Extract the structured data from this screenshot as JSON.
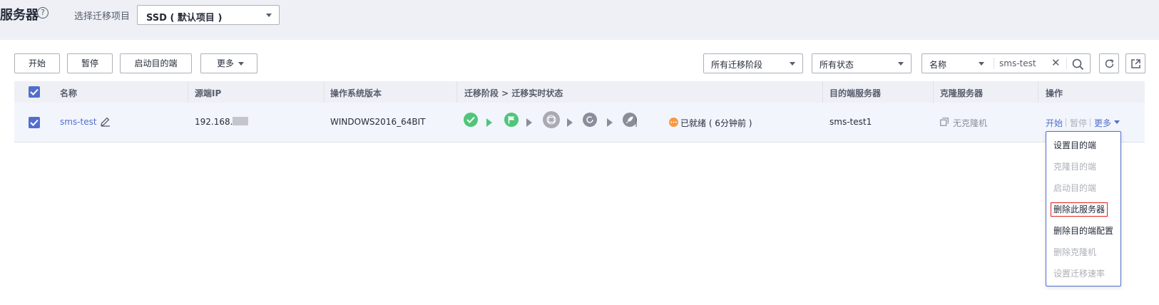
{
  "header": {
    "title": "服务器",
    "help": "?",
    "project_label": "选择迁移项目",
    "project_value": "SSD ( 默认项目 )"
  },
  "toolbar": {
    "start": "开始",
    "pause": "暂停",
    "start_target": "启动目的端",
    "more": "更多",
    "stage_filter": "所有迁移阶段",
    "status_filter": "所有状态",
    "search_field": "名称",
    "search_query": "sms-test"
  },
  "table": {
    "columns": [
      "名称",
      "源端IP",
      "操作系统版本",
      "迁移阶段 > 迁移实时状态",
      "目的端服务器",
      "克隆服务器",
      "操作"
    ],
    "rows": [
      {
        "name": "sms-test",
        "ip": "192.168.",
        "os": "WINDOWS2016_64BIT",
        "separator": "|",
        "status": "已就绪 ( 6分钟前 )",
        "target": "sms-test1",
        "clone": "无克隆机",
        "ops": {
          "start": "开始",
          "pause": "暂停",
          "more": "更多"
        }
      }
    ]
  },
  "menu": {
    "items": [
      {
        "label": "设置目的端",
        "enabled": true
      },
      {
        "label": "克隆目的端",
        "enabled": false
      },
      {
        "label": "启动目的端",
        "enabled": false
      },
      {
        "label": "删除此服务器",
        "enabled": true,
        "highlighted": true
      },
      {
        "label": "删除目的端配置",
        "enabled": true
      },
      {
        "label": "删除克隆机",
        "enabled": false
      },
      {
        "label": "设置迁移速率",
        "enabled": false
      }
    ]
  },
  "colors": {
    "accent": "#526ecc",
    "success": "#50c57a",
    "pending": "#8a8e99",
    "warning": "#fa9841",
    "highlight_border": "#e02020"
  },
  "icons": {
    "stage1": "check-circle-icon",
    "stage2": "flag-icon",
    "stage3": "sync-icon",
    "stage4": "refresh-icon",
    "stage5": "rocket-icon"
  }
}
